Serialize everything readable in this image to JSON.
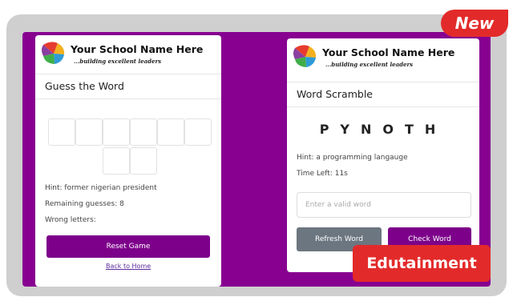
{
  "badges": {
    "new": "New",
    "category": "Edutainment"
  },
  "brand": {
    "school_name": "Your School Name Here",
    "tagline": "...building excellent leaders"
  },
  "guess_the_word": {
    "title": "Guess the Word",
    "hint": "Hint: former nigerian president",
    "remaining": "Remaining guesses: 8",
    "wrong_letters": "Wrong letters:",
    "reset_button": "Reset Game",
    "back_link": "Back to Home",
    "letter_tiles": [
      "",
      "",
      "",
      "",
      "",
      "",
      "",
      ""
    ]
  },
  "word_scramble": {
    "title": "Word Scramble",
    "scrambled": "PYNOTH",
    "hint": "Hint: a programming langauge",
    "time_left": "Time Left: 11s",
    "input_placeholder": "Enter a valid word",
    "refresh_button": "Refresh Word",
    "check_button": "Check Word"
  },
  "colors": {
    "stage_purple": "#870090",
    "button_purple": "#7d008a",
    "badge_red": "#e32a2a",
    "frame_gray": "#cfcfcf"
  }
}
